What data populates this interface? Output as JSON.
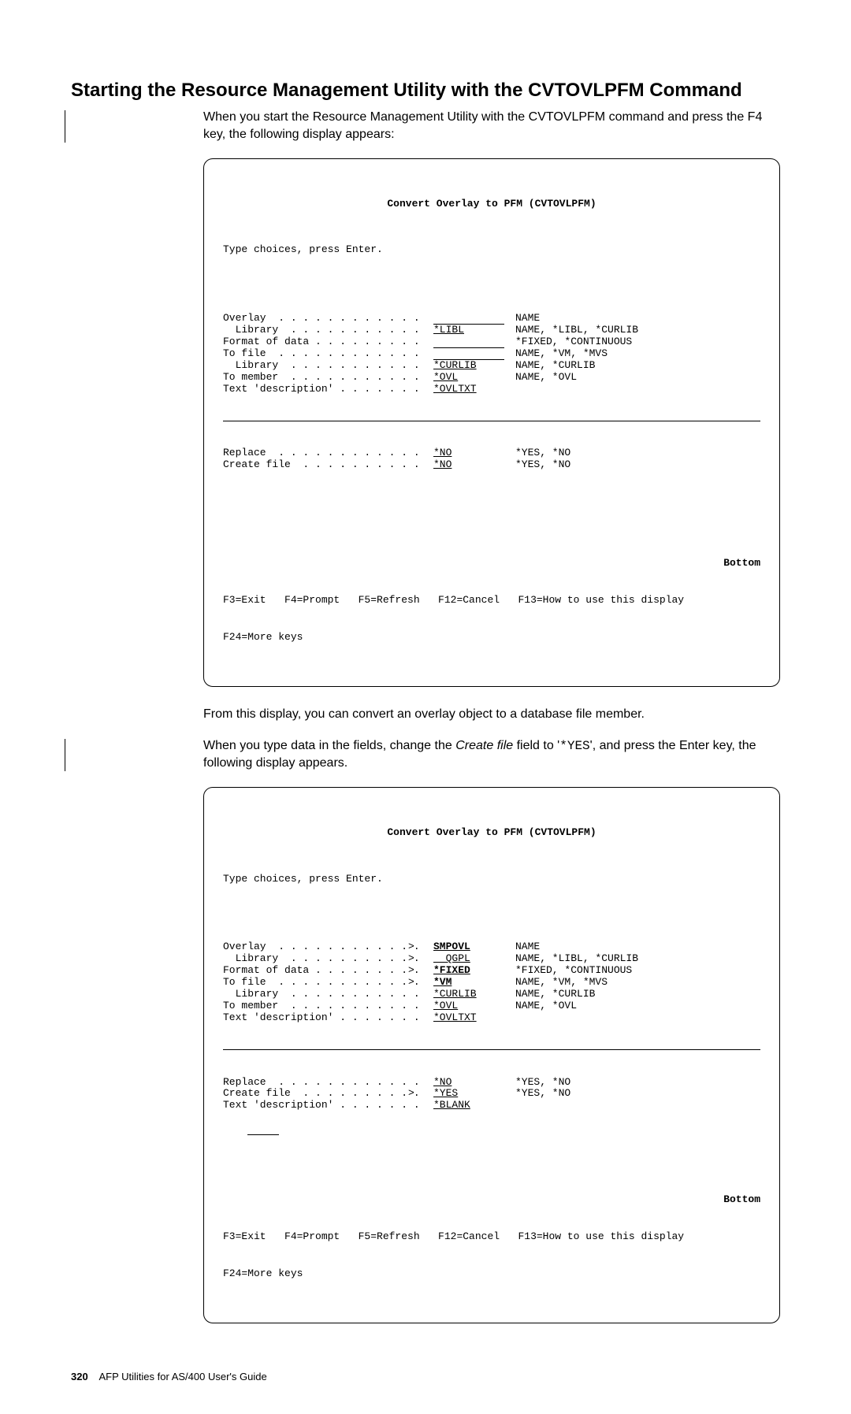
{
  "heading": "Starting the Resource Management Utility with the CVTOVLPFM Command",
  "intro": "When you start the Resource Management Utility with the CVTOVLPFM command and press the F4 key, the following display appears:",
  "screen1": {
    "title": "Convert Overlay to PFM (CVTOVLPFM)",
    "prompt": "Type choices, press Enter.",
    "fields": [
      {
        "label": "Overlay  . . . . . . . . . . . .",
        "mid": "",
        "value": "",
        "uclass": "u90",
        "hint": "NAME"
      },
      {
        "label": "  Library  . . . . . . . . . . .",
        "mid": "",
        "value": "*LIBL",
        "uclass": "u90",
        "hint": "NAME, *LIBL, *CURLIB"
      },
      {
        "label": "Format of data . . . . . . . . .",
        "mid": "",
        "value": "",
        "uclass": "u90",
        "hint": "*FIXED, *CONTINUOUS"
      },
      {
        "label": "To file  . . . . . . . . . . . .",
        "mid": "",
        "value": "",
        "uclass": "u90",
        "hint": "NAME, *VM, *MVS"
      },
      {
        "label": "  Library  . . . . . . . . . . .",
        "mid": "",
        "value": "*CURLIB",
        "uclass": "u90",
        "hint": "NAME, *CURLIB"
      },
      {
        "label": "To member  . . . . . . . . . . .",
        "mid": "",
        "value": "*OVL",
        "uclass": "u90",
        "hint": "NAME, *OVL"
      },
      {
        "label": "Text 'description' . . . . . . .",
        "mid": "",
        "value": "*OVLTXT",
        "uclass": "",
        "hint": ""
      }
    ],
    "fields2": [
      {
        "label": "Replace  . . . . . . . . . . . .",
        "mid": "",
        "value": "*NO",
        "uclass": "u80",
        "hint": "*YES, *NO"
      },
      {
        "label": "Create file  . . . . . . . . . .",
        "mid": "",
        "value": "*NO",
        "uclass": "u80",
        "hint": "*YES, *NO"
      }
    ],
    "bottom": "Bottom",
    "fkeys1": "F3=Exit   F4=Prompt   F5=Refresh   F12=Cancel   F13=How to use this display",
    "fkeys2": "F24=More keys"
  },
  "para2a": "From this display, you can convert an overlay object to a database file member.",
  "para2b_prefix": "When you type data in the fields, change the ",
  "para2b_italic": "Create file",
  "para2b_mid": " field to '",
  "para2b_mono": "*YES",
  "para2b_suffix": "', and press the Enter key, the following display appears.",
  "screen2": {
    "title": "Convert Overlay to PFM (CVTOVLPFM)",
    "prompt": "Type choices, press Enter.",
    "fields": [
      {
        "label": "Overlay  . . . . . . . . . . . .",
        "mid": "> ",
        "value": "SMPOVL",
        "uclass": "u80",
        "hint": "NAME",
        "bold": true
      },
      {
        "label": "  Library  . . . . . . . . . . .",
        "mid": "> ",
        "value": "  QGPL",
        "uclass": "u80",
        "hint": "NAME, *LIBL, *CURLIB"
      },
      {
        "label": "Format of data . . . . . . . . .",
        "mid": "> ",
        "value": "*FIXED",
        "uclass": "u80",
        "hint": "*FIXED, *CONTINUOUS",
        "bold": true
      },
      {
        "label": "To file  . . . . . . . . . . . .",
        "mid": "> ",
        "value": "*VM",
        "uclass": "u80",
        "hint": "NAME, *VM, *MVS",
        "bold": true
      },
      {
        "label": "  Library  . . . . . . . . . . .",
        "mid": "  ",
        "value": "*CURLIB",
        "uclass": "u80",
        "hint": "NAME, *CURLIB"
      },
      {
        "label": "To member  . . . . . . . . . . .",
        "mid": "  ",
        "value": "*OVL",
        "uclass": "u80",
        "hint": "NAME, *OVL"
      },
      {
        "label": "Text 'description' . . . . . . .",
        "mid": "  ",
        "value": "*OVLTXT",
        "uclass": "",
        "hint": ""
      }
    ],
    "fields2": [
      {
        "label": "Replace  . . . . . . . . . . . .",
        "mid": "  ",
        "value": "*NO",
        "uclass": "u80",
        "hint": "*YES, *NO"
      },
      {
        "label": "Create file  . . . . . . . . . .",
        "mid": "> ",
        "value": "*YES",
        "uclass": "u80",
        "hint": "*YES, *NO"
      },
      {
        "label": "Text 'description' . . . . . . .",
        "mid": "  ",
        "value": "*BLANK",
        "uclass": "",
        "hint": ""
      }
    ],
    "bottom": "Bottom",
    "fkeys1": "F3=Exit   F4=Prompt   F5=Refresh   F12=Cancel   F13=How to use this display",
    "fkeys2": "F24=More keys"
  },
  "footer": {
    "page": "320",
    "text": "AFP Utilities for AS/400 User's Guide"
  }
}
